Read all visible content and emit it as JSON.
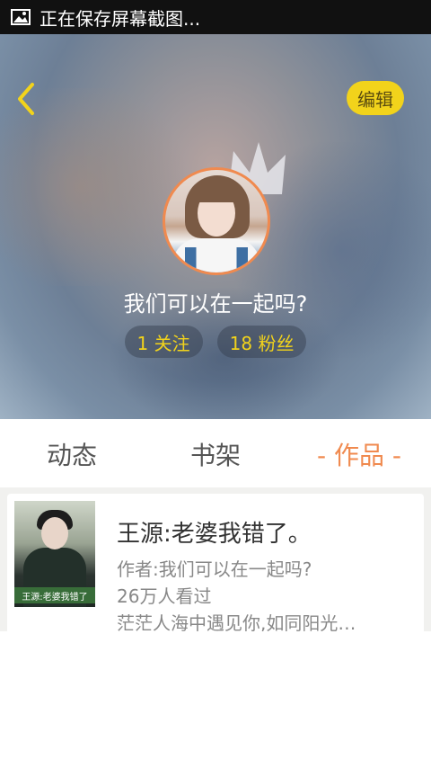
{
  "status_bar": {
    "text": "正在保存屏幕截图..."
  },
  "header": {
    "edit_label": "编辑",
    "username": "我们可以在一起吗?",
    "following_label": "1 关注",
    "followers_label": "18 粉丝"
  },
  "tabs": [
    {
      "label": "动态"
    },
    {
      "label": "书架"
    },
    {
      "label": "作品"
    }
  ],
  "works": [
    {
      "cover_caption": "王源:老婆我错了",
      "title": "王源:老婆我错了。",
      "author": "作者:我们可以在一起吗?",
      "views": "26万人看过",
      "desc": "茫茫人海中遇见你,如同阳光…"
    }
  ],
  "colors": {
    "accent": "#f08a4f",
    "edit_button": "#f2d31b",
    "stat_text": "#f2d31b"
  }
}
